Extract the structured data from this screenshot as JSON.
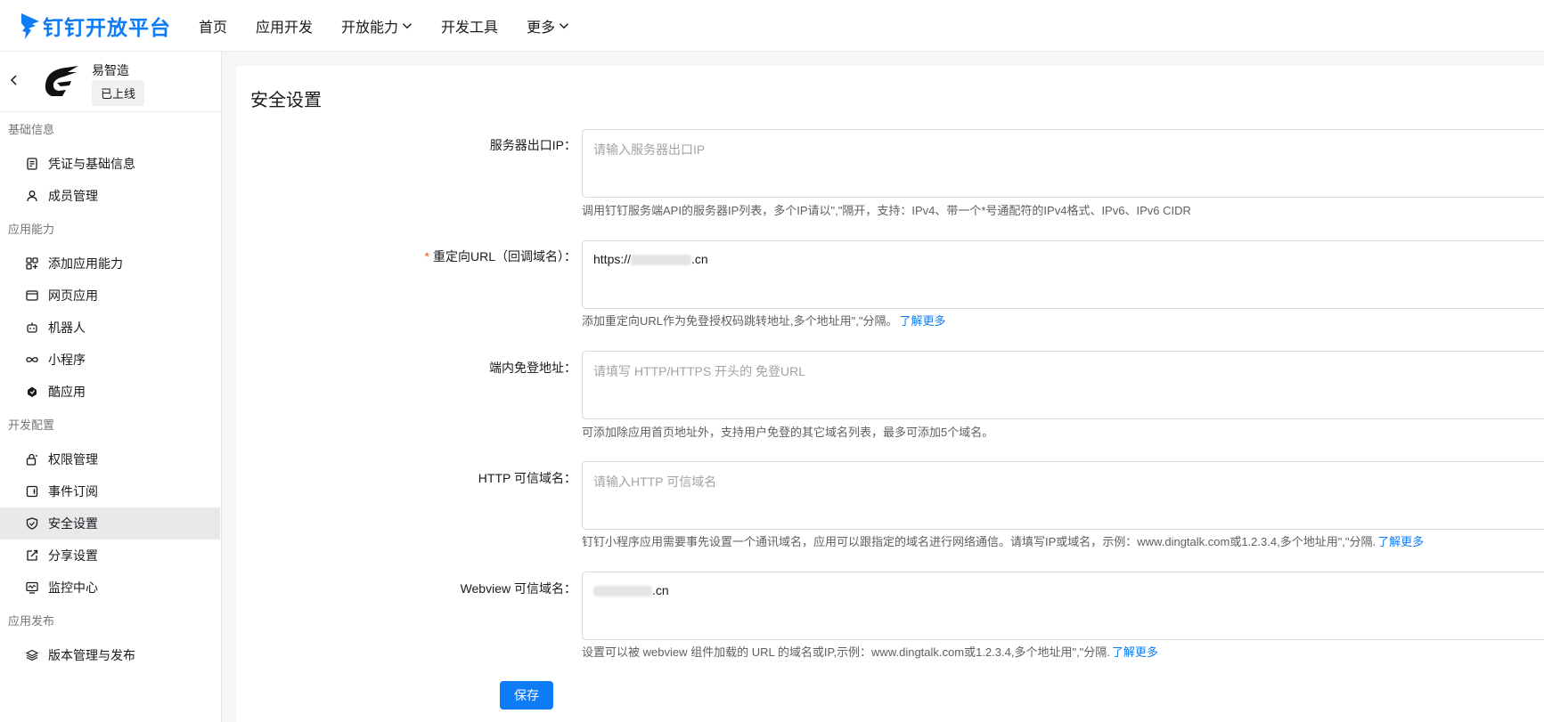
{
  "brand": {
    "name": "钉钉开放平台",
    "color": "#0d7cf5"
  },
  "nav": {
    "items": [
      {
        "label": "首页",
        "has_dropdown": false
      },
      {
        "label": "应用开发",
        "has_dropdown": false
      },
      {
        "label": "开放能力",
        "has_dropdown": true
      },
      {
        "label": "开发工具",
        "has_dropdown": false
      },
      {
        "label": "更多",
        "has_dropdown": true
      }
    ]
  },
  "app": {
    "name": "易智造",
    "status": "已上线"
  },
  "sidebar": {
    "groups": [
      {
        "title": "基础信息",
        "items": [
          {
            "label": "凭证与基础信息",
            "icon": "credential-icon"
          },
          {
            "label": "成员管理",
            "icon": "member-icon"
          }
        ]
      },
      {
        "title": "应用能力",
        "items": [
          {
            "label": "添加应用能力",
            "icon": "add-capability-icon"
          },
          {
            "label": "网页应用",
            "icon": "web-app-icon"
          },
          {
            "label": "机器人",
            "icon": "robot-icon"
          },
          {
            "label": "小程序",
            "icon": "mini-program-icon"
          },
          {
            "label": "酷应用",
            "icon": "cool-app-icon"
          }
        ]
      },
      {
        "title": "开发配置",
        "items": [
          {
            "label": "权限管理",
            "icon": "permission-icon"
          },
          {
            "label": "事件订阅",
            "icon": "event-subscription-icon"
          },
          {
            "label": "安全设置",
            "icon": "shield-icon",
            "active": true
          },
          {
            "label": "分享设置",
            "icon": "share-icon"
          },
          {
            "label": "监控中心",
            "icon": "monitor-icon"
          }
        ]
      },
      {
        "title": "应用发布",
        "items": [
          {
            "label": "版本管理与发布",
            "icon": "layers-icon"
          }
        ]
      }
    ]
  },
  "page": {
    "title": "安全设置",
    "fields": [
      {
        "label": "服务器出口IP：",
        "required": false,
        "value": "",
        "placeholder": "请输入服务器出口IP",
        "hint": "调用钉钉服务端API的服务器IP列表，多个IP请以\",\"隔开，支持：IPv4、带一个*号通配符的IPv4格式、IPv6、IPv6 CIDR",
        "link": ""
      },
      {
        "label": "重定向URL（回调域名）：",
        "required": true,
        "value_prefix": "https://",
        "value_suffix": ".cn",
        "placeholder": "",
        "hint": "添加重定向URL作为免登授权码跳转地址,多个地址用\",\"分隔。",
        "link": "了解更多"
      },
      {
        "label": "端内免登地址：",
        "required": false,
        "value": "",
        "placeholder": "请填写 HTTP/HTTPS 开头的 免登URL",
        "hint": "可添加除应用首页地址外，支持用户免登的其它域名列表，最多可添加5个域名。",
        "link": ""
      },
      {
        "label": "HTTP 可信域名：",
        "required": false,
        "value": "",
        "placeholder": "请输入HTTP 可信域名",
        "hint": "钉钉小程序应用需要事先设置一个通讯域名，应用可以跟指定的域名进行网络通信。请填写IP或域名，示例：www.dingtalk.com或1.2.3.4,多个地址用\",\"分隔.",
        "link": "了解更多"
      },
      {
        "label": "Webview 可信域名：",
        "required": false,
        "value_prefix": "",
        "value_suffix": ".cn",
        "placeholder": "",
        "hint": "设置可以被 webview 组件加载的 URL 的域名或IP,示例：www.dingtalk.com或1.2.3.4,多个地址用\",\"分隔.",
        "link": "了解更多"
      }
    ],
    "save_label": "保存"
  }
}
